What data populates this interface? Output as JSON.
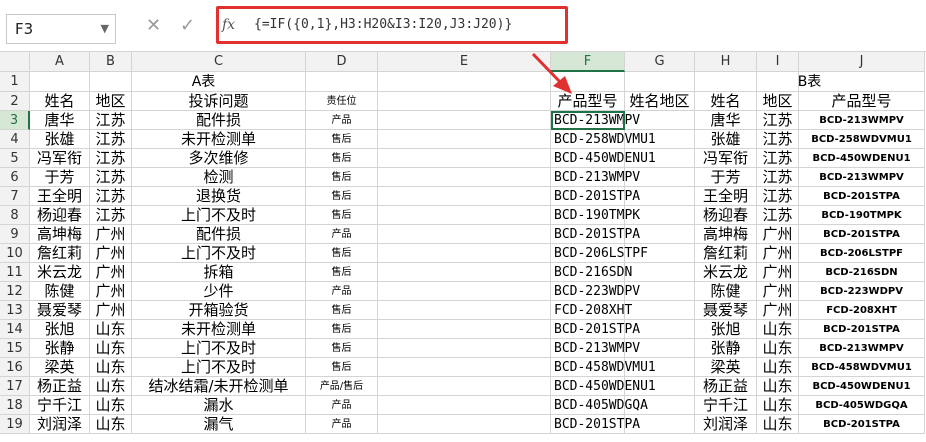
{
  "formula_bar": {
    "name_box": "F3",
    "cancel_icon": "✕",
    "enter_icon": "✓",
    "fx_label": "fx",
    "formula": "{=IF({0,1},H3:H20&I3:I20,J3:J20)}"
  },
  "columns": [
    "A",
    "B",
    "C",
    "D",
    "E",
    "F",
    "G",
    "H",
    "I",
    "J"
  ],
  "rows": [
    "1",
    "2",
    "3",
    "4",
    "5",
    "6",
    "7",
    "8",
    "9",
    "10",
    "11",
    "12",
    "13",
    "14",
    "15",
    "16",
    "17",
    "18",
    "19"
  ],
  "table_a": {
    "title": "A表",
    "headers": [
      "姓名",
      "地区",
      "投诉问题",
      "责任位"
    ],
    "rows": [
      [
        "唐华",
        "江苏",
        "配件损",
        "产品"
      ],
      [
        "张雄",
        "江苏",
        "未开检测单",
        "售后"
      ],
      [
        "冯军衔",
        "江苏",
        "多次维修",
        "售后"
      ],
      [
        "于芳",
        "江苏",
        "检测",
        "售后"
      ],
      [
        "王全明",
        "江苏",
        "退换货",
        "售后"
      ],
      [
        "杨迎春",
        "江苏",
        "上门不及时",
        "售后"
      ],
      [
        "高坤梅",
        "广州",
        "配件损",
        "产品"
      ],
      [
        "詹红莉",
        "广州",
        "上门不及时",
        "售后"
      ],
      [
        "米云龙",
        "广州",
        "拆箱",
        "售后"
      ],
      [
        "陈健",
        "广州",
        "少件",
        "产品"
      ],
      [
        "聂爱琴",
        "广州",
        "开箱验货",
        "售后"
      ],
      [
        "张旭",
        "山东",
        "未开检测单",
        "售后"
      ],
      [
        "张静",
        "山东",
        "上门不及时",
        "售后"
      ],
      [
        "梁英",
        "山东",
        "上门不及时",
        "售后"
      ],
      [
        "杨正益",
        "山东",
        "结冰结霜/未开检测单",
        "产品/售后"
      ],
      [
        "宁千江",
        "山东",
        "漏水",
        "产品"
      ],
      [
        "刘润泽",
        "山东",
        "漏气",
        "产品"
      ]
    ]
  },
  "helper": {
    "headers": [
      "产品型号",
      "姓名地区"
    ],
    "values": [
      "BCD-213WMPV",
      "BCD-258WDVMU1",
      "BCD-450WDENU1",
      "BCD-213WMPV",
      "BCD-201STPA",
      "BCD-190TMPK",
      "BCD-201STPA",
      "BCD-206LSTPF",
      "BCD-216SDN",
      "BCD-223WDPV",
      "FCD-208XHT",
      "BCD-201STPA",
      "BCD-213WMPV",
      "BCD-458WDVMU1",
      "BCD-450WDENU1",
      "BCD-405WDGQA",
      "BCD-201STPA"
    ]
  },
  "table_b": {
    "title": "B表",
    "headers": [
      "姓名",
      "地区",
      "产品型号"
    ],
    "rows": [
      [
        "唐华",
        "江苏",
        "BCD-213WMPV"
      ],
      [
        "张雄",
        "江苏",
        "BCD-258WDVMU1"
      ],
      [
        "冯军衔",
        "江苏",
        "BCD-450WDENU1"
      ],
      [
        "于芳",
        "江苏",
        "BCD-213WMPV"
      ],
      [
        "王全明",
        "江苏",
        "BCD-201STPA"
      ],
      [
        "杨迎春",
        "江苏",
        "BCD-190TMPK"
      ],
      [
        "高坤梅",
        "广州",
        "BCD-201STPA"
      ],
      [
        "詹红莉",
        "广州",
        "BCD-206LSTPF"
      ],
      [
        "米云龙",
        "广州",
        "BCD-216SDN"
      ],
      [
        "陈健",
        "广州",
        "BCD-223WDPV"
      ],
      [
        "聂爱琴",
        "广州",
        "FCD-208XHT"
      ],
      [
        "张旭",
        "山东",
        "BCD-201STPA"
      ],
      [
        "张静",
        "山东",
        "BCD-213WMPV"
      ],
      [
        "梁英",
        "山东",
        "BCD-458WDVMU1"
      ],
      [
        "杨正益",
        "山东",
        "BCD-450WDENU1"
      ],
      [
        "宁千江",
        "山东",
        "BCD-405WDGQA"
      ],
      [
        "刘润泽",
        "山东",
        "BCD-201STPA"
      ]
    ]
  },
  "colors": {
    "selection": "#217346",
    "highlight": "#e03030",
    "grid": "#d4d4d4"
  }
}
